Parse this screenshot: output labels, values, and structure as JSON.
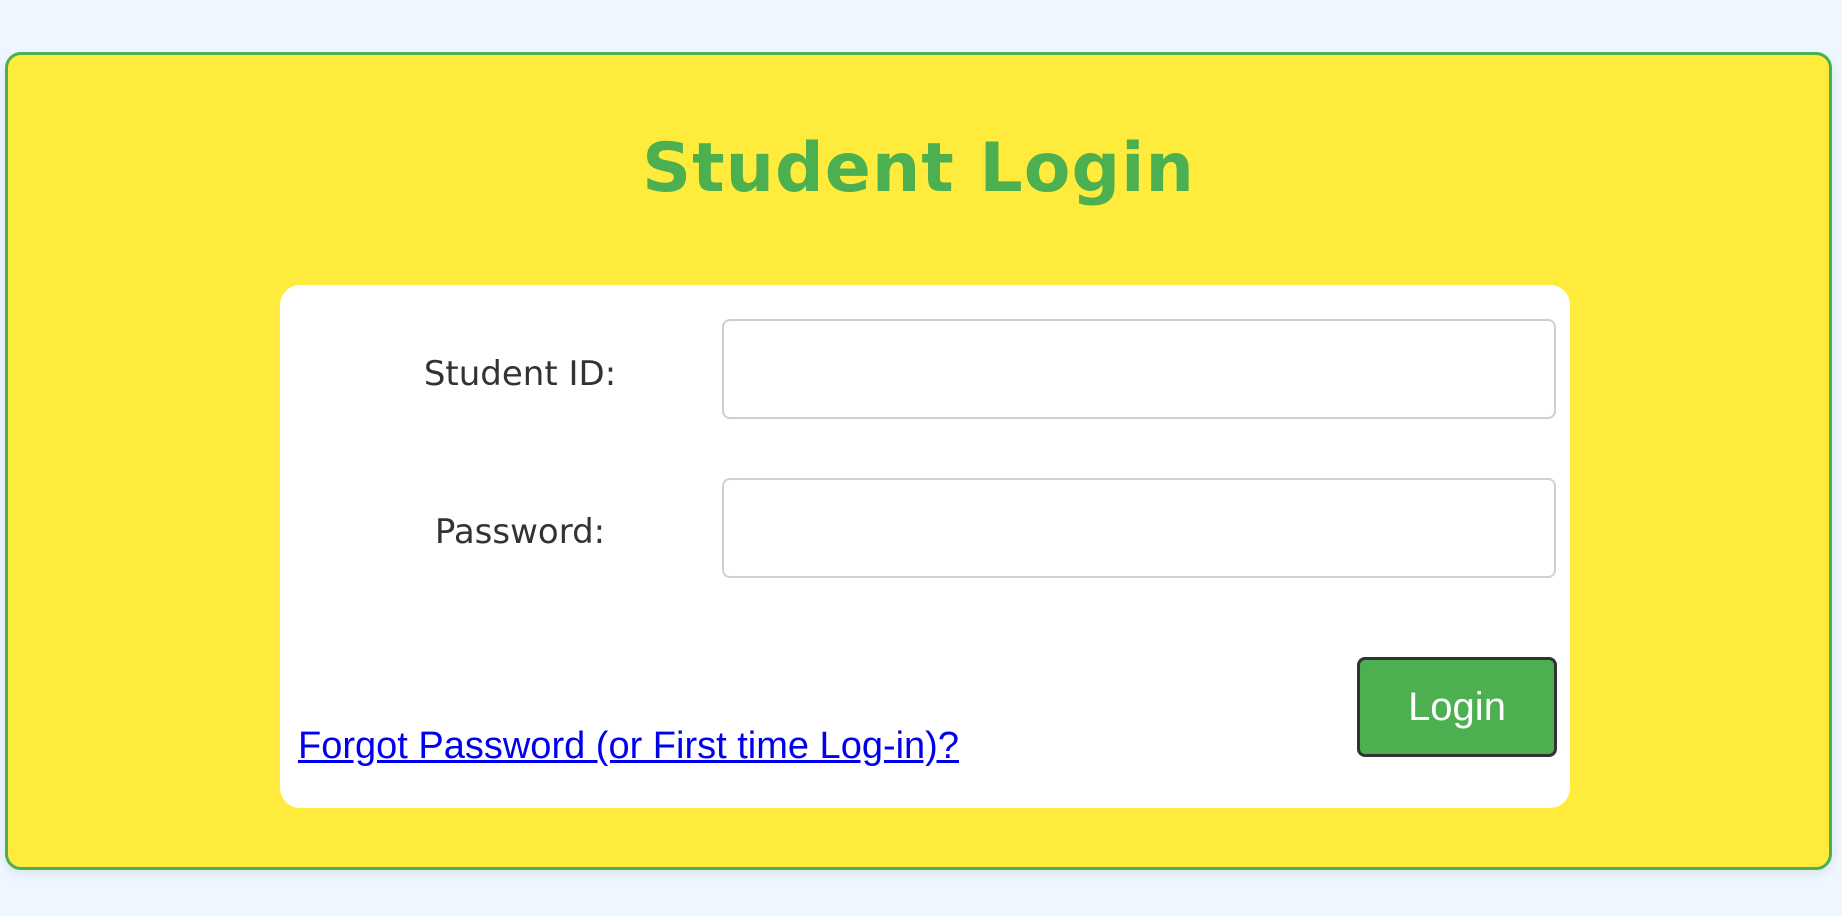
{
  "page": {
    "title": "Student Login"
  },
  "form": {
    "student_id_label": "Student ID:",
    "student_id_value": "",
    "password_label": "Password:",
    "password_value": "",
    "login_label": "Login",
    "forgot_link": "Forgot Password (or First time Log-in)?"
  },
  "colors": {
    "page_background": "#eef6ff",
    "card_background": "#ffeb3b",
    "accent_green": "#4caf50",
    "link_blue": "#0000ee"
  }
}
